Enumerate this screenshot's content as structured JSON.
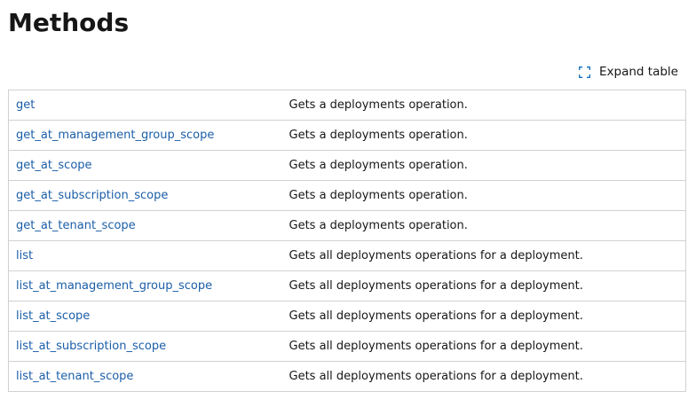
{
  "page": {
    "title": "Methods"
  },
  "toolbar": {
    "expand_icon": "expand-icon",
    "expand_label": "Expand table"
  },
  "colors": {
    "link": "#1b5ea8",
    "text": "#161616",
    "border": "#d1d1d1",
    "icon": "#0f6cbd"
  },
  "methods": [
    {
      "name": "get",
      "description": "Gets a deployments operation."
    },
    {
      "name": "get_at_management_group_scope",
      "description": "Gets a deployments operation."
    },
    {
      "name": "get_at_scope",
      "description": "Gets a deployments operation."
    },
    {
      "name": "get_at_subscription_scope",
      "description": "Gets a deployments operation."
    },
    {
      "name": "get_at_tenant_scope",
      "description": "Gets a deployments operation."
    },
    {
      "name": "list",
      "description": "Gets all deployments operations for a deployment."
    },
    {
      "name": "list_at_management_group_scope",
      "description": "Gets all deployments operations for a deployment."
    },
    {
      "name": "list_at_scope",
      "description": "Gets all deployments operations for a deployment."
    },
    {
      "name": "list_at_subscription_scope",
      "description": "Gets all deployments operations for a deployment."
    },
    {
      "name": "list_at_tenant_scope",
      "description": "Gets all deployments operations for a deployment."
    }
  ]
}
